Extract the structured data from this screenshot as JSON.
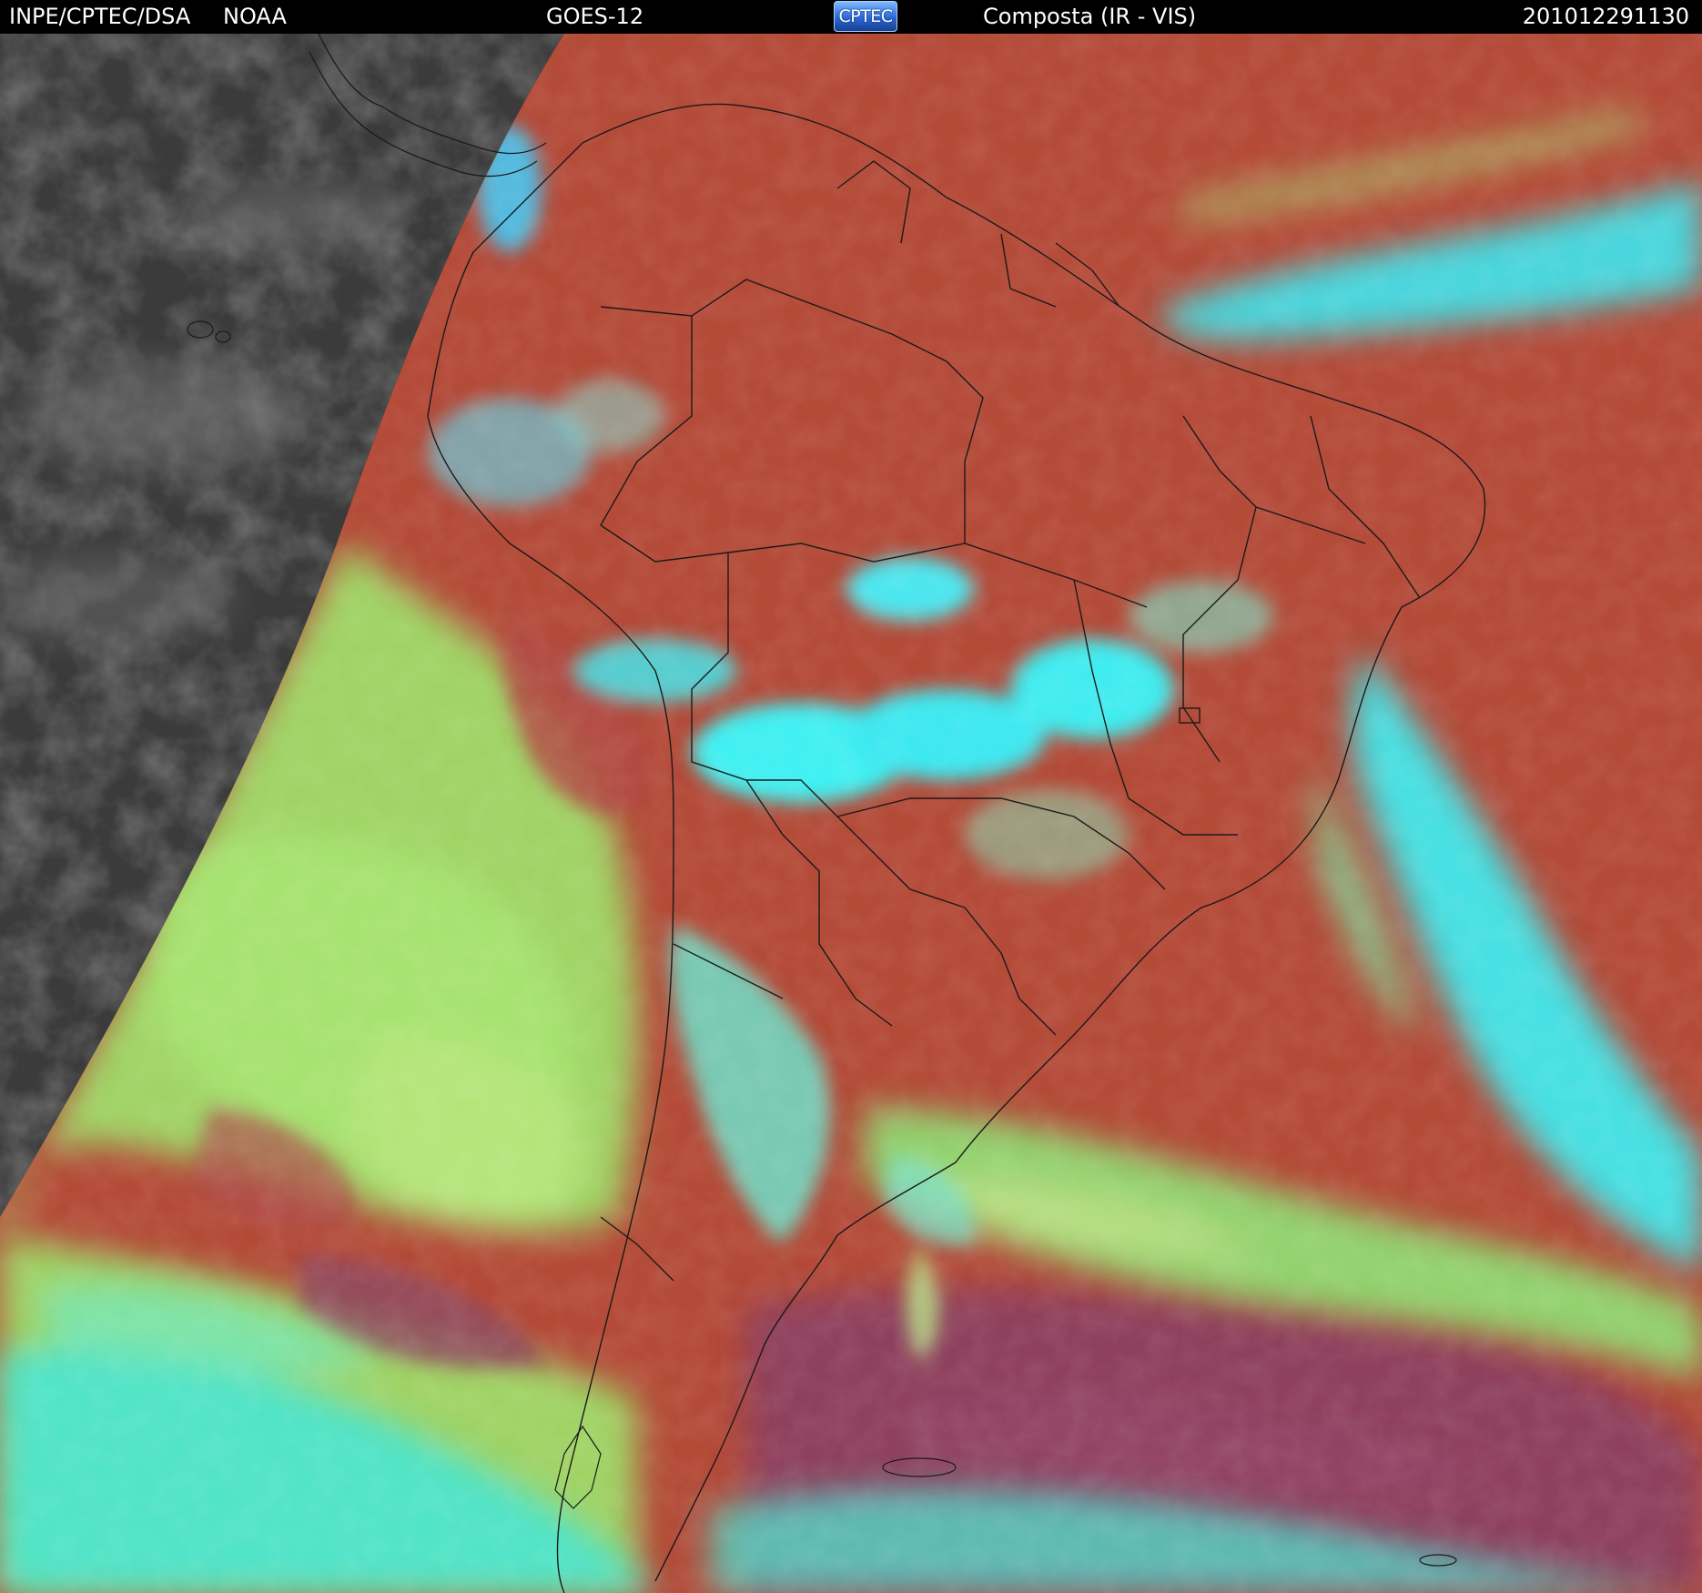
{
  "header": {
    "organization": "INPE/CPTEC/DSA",
    "agency": "NOAA",
    "satellite": "GOES-12",
    "logo_text": "CPTEC",
    "product": "Composta (IR - VIS)",
    "timestamp": "201012291130"
  },
  "colors": {
    "night_side": "#3f3f3f",
    "clear_land_ocean": "#b04a3a",
    "high_cloud": "#3fe6f0",
    "low_cloud": "#9ee46a",
    "cold_ocean": "#8a3f5c"
  }
}
